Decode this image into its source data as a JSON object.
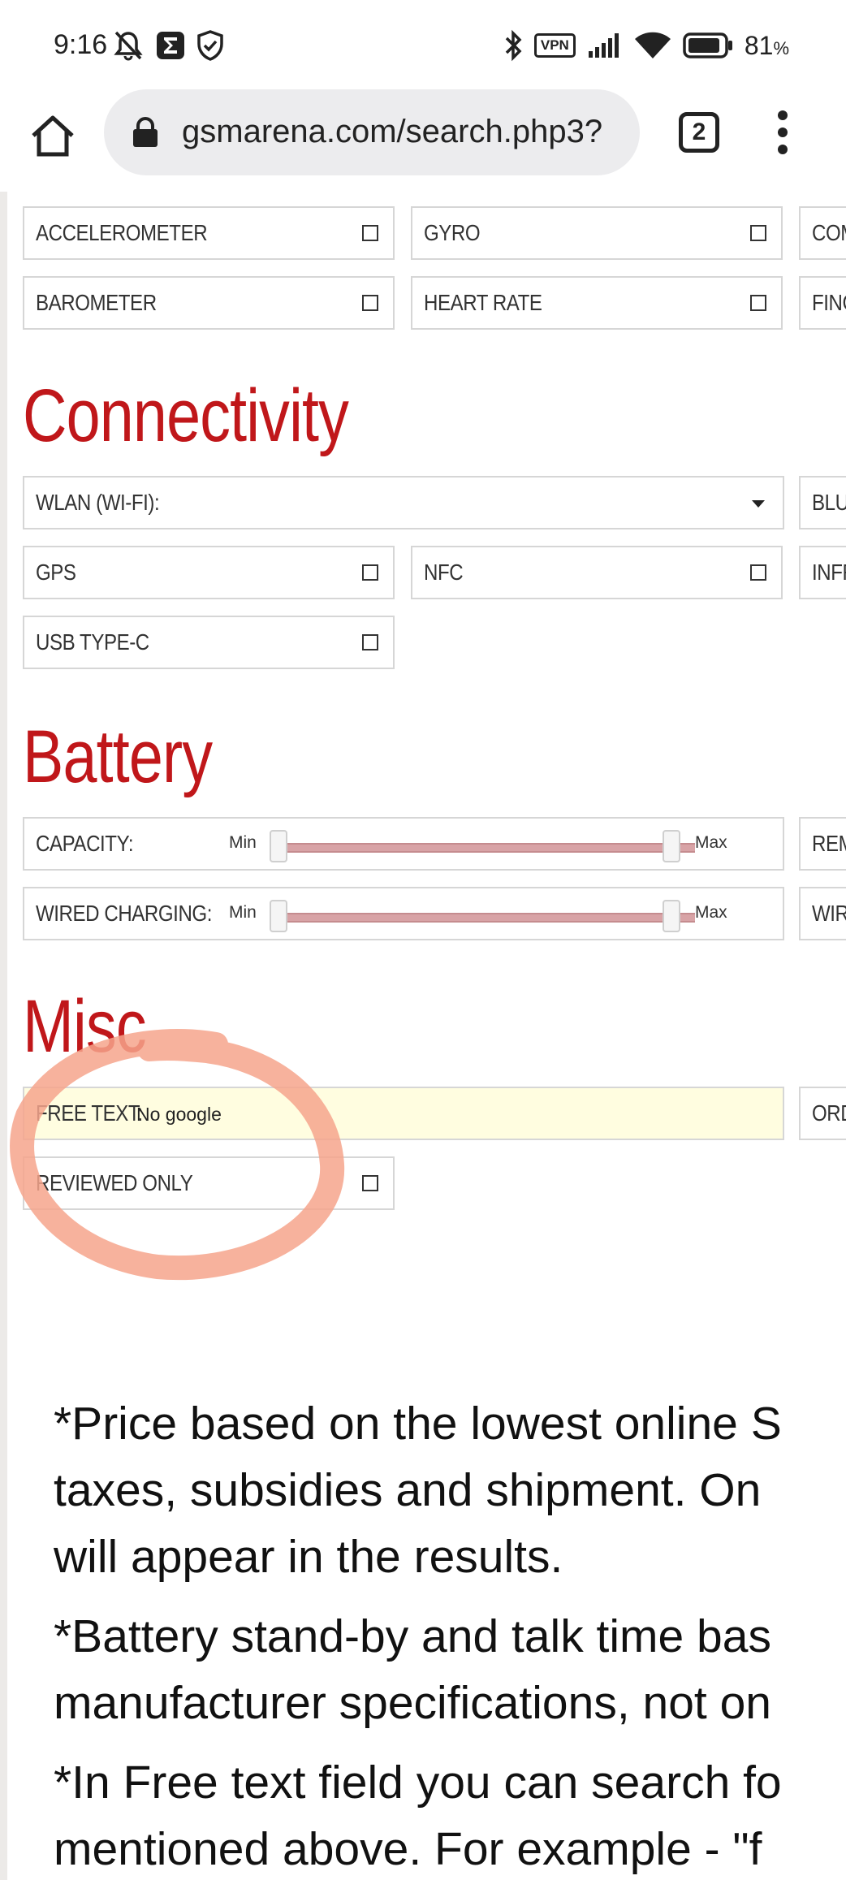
{
  "status_bar": {
    "time": "9:16",
    "left_icons": [
      "muted-bell-icon",
      "sigma-app-icon",
      "shield-icon"
    ],
    "right_icons": [
      "bluetooth-icon",
      "vpn-icon",
      "signal-icon",
      "wifi-icon",
      "battery-icon"
    ],
    "vpn_label": "VPN",
    "battery_value": "81",
    "battery_pct": "%"
  },
  "browser": {
    "url": "gsmarena.com/search.php3?",
    "tab_count": "2"
  },
  "sensors": {
    "row1": [
      "ACCELEROMETER",
      "GYRO",
      "COM"
    ],
    "row2": [
      "BAROMETER",
      "HEART RATE",
      "FING"
    ]
  },
  "connectivity": {
    "heading": "Connectivity",
    "wlan_label": "WLAN (WI-FI):",
    "right_clip_1": "BLU",
    "gps_label": "GPS",
    "nfc_label": "NFC",
    "right_clip_2": "INFR",
    "usb_label": "USB TYPE-C"
  },
  "battery": {
    "heading": "Battery",
    "capacity_label": "CAPACITY:",
    "wired_label": "WIRED CHARGING:",
    "min_label": "Min",
    "max_label": "Max",
    "right_clip_1": "REM",
    "right_clip_2": "WIR"
  },
  "misc": {
    "heading": "Misc",
    "free_text_label": "FREE TEXT:",
    "free_text_value": "No google",
    "right_clip": "ORD",
    "reviewed_label": "REVIEWED ONLY"
  },
  "notes": {
    "p1_l1": "*Price based on the lowest online S",
    "p1_l2": "taxes, subsidies and shipment. On",
    "p1_l3": "will appear in the results.",
    "p2_l1": "*Battery stand-by and talk time bas",
    "p2_l2": "manufacturer specifications, not on",
    "p3_l1": "*In Free text field you can search fo",
    "p3_l2": "mentioned above. For example - \"f"
  },
  "colors": {
    "heading_red": "#c0171a",
    "annotation_orange": "#f6a58c",
    "free_text_bg": "#fffde0"
  }
}
